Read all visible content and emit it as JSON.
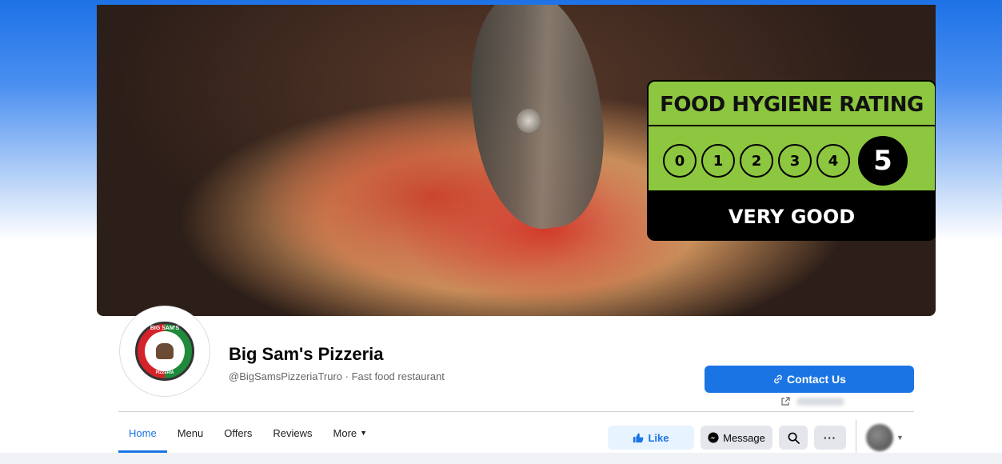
{
  "cover": {
    "hygiene_title": "FOOD HYGIENE RATING",
    "ratings": [
      "0",
      "1",
      "2",
      "3",
      "4",
      "5"
    ],
    "active_rating": "5",
    "hygiene_verdict": "VERY GOOD"
  },
  "profile": {
    "logo_top_text": "BIG SAM'S",
    "logo_bottom_text": "PIZZERIA",
    "name": "Big Sam's Pizzeria",
    "handle": "@BigSamsPizzeriaTruro · Fast food restaurant"
  },
  "contact": {
    "label": "Contact Us",
    "icon": "link-icon"
  },
  "tabs": [
    {
      "label": "Home",
      "active": true
    },
    {
      "label": "Menu",
      "active": false
    },
    {
      "label": "Offers",
      "active": false
    },
    {
      "label": "Reviews",
      "active": false
    },
    {
      "label": "More",
      "active": false
    }
  ],
  "actions": {
    "like_label": "Like",
    "message_label": "Message",
    "more_label": "···"
  },
  "colors": {
    "accent": "#1b74e4",
    "hygiene_green": "#8dc63f"
  }
}
